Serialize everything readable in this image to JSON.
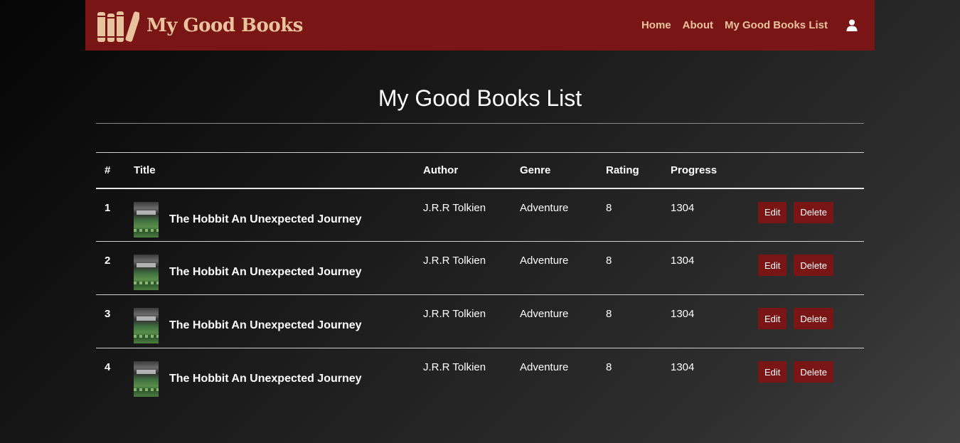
{
  "colors": {
    "brand": "#7a1515",
    "brand_text": "#e8c39e",
    "background": "#1c1c1c",
    "text": "#ffffff"
  },
  "navbar": {
    "brand_name": "My Good Books",
    "logo_icon": "books-icon",
    "links": [
      {
        "label": "Home"
      },
      {
        "label": "About"
      },
      {
        "label": "My Good Books List"
      }
    ],
    "user_icon": "user-icon"
  },
  "page": {
    "title": "My Good Books List"
  },
  "table": {
    "headers": {
      "num": "#",
      "title": "Title",
      "author": "Author",
      "genre": "Genre",
      "rating": "Rating",
      "progress": "Progress"
    },
    "rows": [
      {
        "num": "1",
        "title": "The Hobbit An Unexpected Journey",
        "author": "J.R.R Tolkien",
        "genre": "Adventure",
        "rating": "8",
        "progress": "1304",
        "edit": "Edit",
        "delete": "Delete"
      },
      {
        "num": "2",
        "title": "The Hobbit An Unexpected Journey",
        "author": "J.R.R Tolkien",
        "genre": "Adventure",
        "rating": "8",
        "progress": "1304",
        "edit": "Edit",
        "delete": "Delete"
      },
      {
        "num": "3",
        "title": "The Hobbit An Unexpected Journey",
        "author": "J.R.R Tolkien",
        "genre": "Adventure",
        "rating": "8",
        "progress": "1304",
        "edit": "Edit",
        "delete": "Delete"
      },
      {
        "num": "4",
        "title": "The Hobbit An Unexpected Journey",
        "author": "J.R.R Tolkien",
        "genre": "Adventure",
        "rating": "8",
        "progress": "1304",
        "edit": "Edit",
        "delete": "Delete"
      }
    ]
  }
}
